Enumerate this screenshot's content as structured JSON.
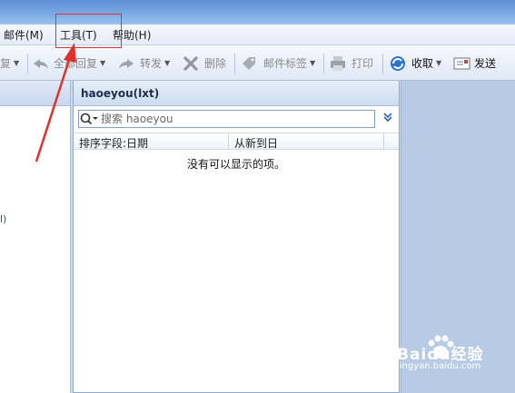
{
  "menubar": {
    "items": [
      {
        "label": "邮件(M)"
      },
      {
        "label": "工具(T)"
      },
      {
        "label": "帮助(H)"
      }
    ]
  },
  "toolbar": {
    "reply_fragment": "复",
    "reply_all_label": "全部回复",
    "forward_label": "转发",
    "delete_label": "删除",
    "tag_label": "邮件标签",
    "print_label": "打印",
    "receive_label": "收取",
    "send_label": "发送"
  },
  "left_pane": {
    "fragment": "l)"
  },
  "mail_list": {
    "folder_title": "haoeyou(lxt)",
    "search_placeholder": "搜索 haoeyou",
    "sort_field_label": "排序字段:日期",
    "sort_order_label": "从新到日",
    "empty_message": "没有可以显示的项。"
  },
  "watermark": {
    "brand": "Baidu经验",
    "url": "jingyan.baidu.com"
  },
  "colors": {
    "highlight": "#e0322c",
    "accent": "#2d5fa8"
  }
}
